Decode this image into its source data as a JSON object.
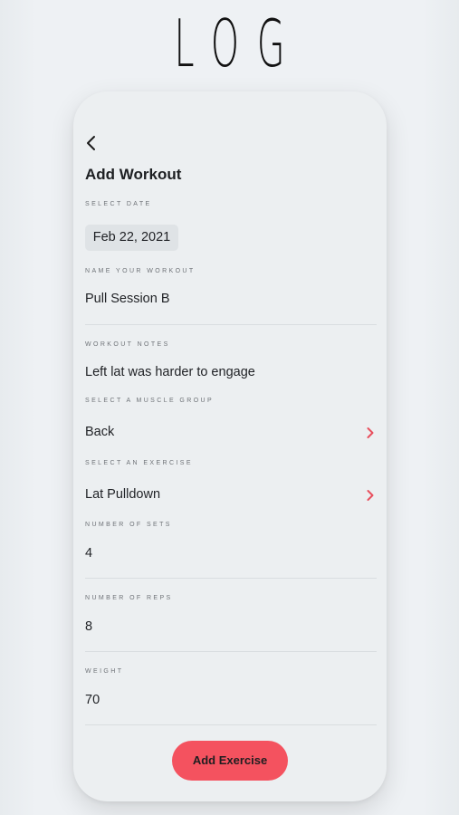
{
  "logo": "LOG",
  "screen": {
    "title": "Add Workout"
  },
  "date": {
    "label": "SELECT DATE",
    "value": "Feb 22, 2021"
  },
  "workout_name": {
    "label": "NAME YOUR WORKOUT",
    "value": "Pull Session B"
  },
  "notes": {
    "label": "WORKOUT NOTES",
    "value": "Left lat was harder to engage"
  },
  "muscle_group": {
    "label": "SELECT A MUSCLE GROUP",
    "value": "Back",
    "icon": "chevron-right-icon"
  },
  "exercise": {
    "label": "SELECT AN EXERCISE",
    "value": "Lat Pulldown",
    "icon": "chevron-right-icon"
  },
  "sets": {
    "label": "NUMBER OF SETS",
    "value": "4"
  },
  "reps": {
    "label": "NUMBER OF REPS",
    "value": "8"
  },
  "weight": {
    "label": "WEIGHT",
    "value": "70"
  },
  "actions": {
    "add_exercise": "Add Exercise"
  },
  "colors": {
    "accent": "#f4525f",
    "chevron": "#e8505e",
    "background": "#eef1f4",
    "phone": "#eceff1"
  }
}
